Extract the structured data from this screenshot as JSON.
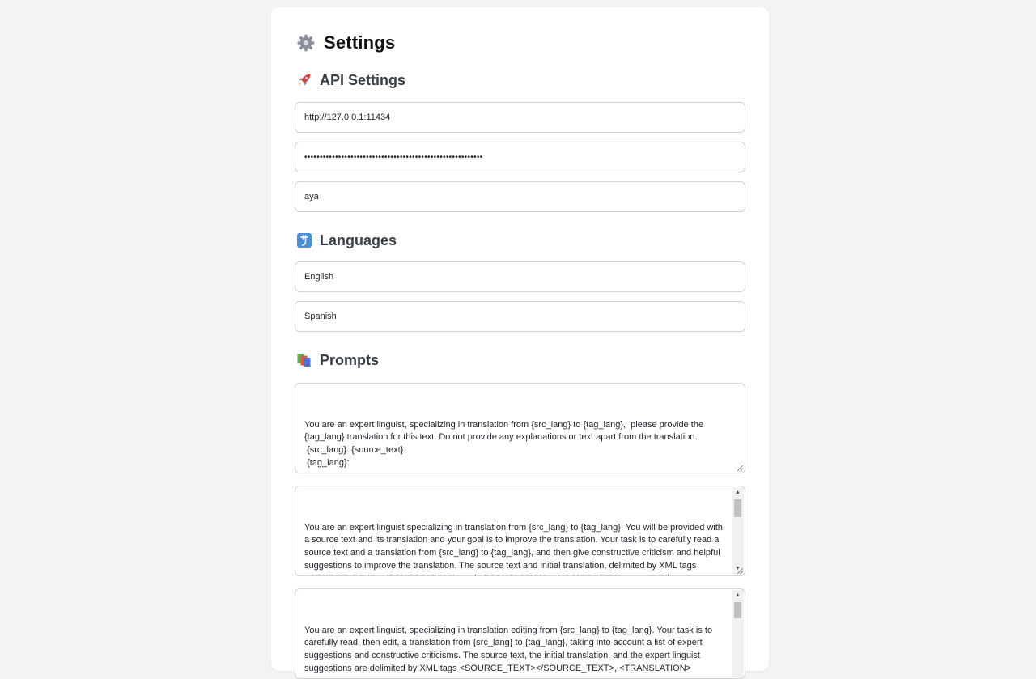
{
  "settings": {
    "title": "Settings",
    "icon": "gear-icon"
  },
  "api": {
    "heading": "API Settings",
    "icon": "rocket-icon",
    "url_value": "http://127.0.0.1:11434",
    "key_value": "••••••••••••••••••••••••••••••••••••••••••••••••••••••••••",
    "model_value": "aya"
  },
  "languages": {
    "heading": "Languages",
    "icon": "language-icon",
    "source_value": "English",
    "target_value": "Spanish"
  },
  "prompts": {
    "heading": "Prompts",
    "icon": "books-icon",
    "prompt1": "You are an expert linguist, specializing in translation from {src_lang} to {tag_lang},  please provide the {tag_lang} translation for this text. Do not provide any explanations or text apart from the translation.\n {src_lang}: {source_text}\n {tag_lang}:",
    "prompt2": "You are an expert linguist specializing in translation from {src_lang} to {tag_lang}. You will be provided with a source text and its translation and your goal is to improve the translation. Your task is to carefully read a source text and a translation from {src_lang} to {tag_lang}, and then give constructive criticism and helpful suggestions to improve the translation. The source text and initial translation, delimited by XML tags <SOURCE_TEXT></SOURCE_TEXT> and <TRANSLATION></TRANSLATION>, are as follows:\n <SOURCE_TEXT>\n {source_text}",
    "prompt3": "You are an expert linguist, specializing in translation editing from {src_lang} to {tag_lang}. Your task is to carefully read, then edit, a translation from {src_lang} to {tag_lang}, taking into account a list of expert suggestions and constructive criticisms. The source text, the initial translation, and the expert linguist suggestions are delimited by XML tags <SOURCE_TEXT></SOURCE_TEXT>, <TRANSLATION>"
  },
  "colors": {
    "background": "#f2f3f5",
    "card": "#ffffff",
    "border": "#cfd3d8",
    "language_icon": "#4a90d9",
    "rocket_red": "#d9413a"
  }
}
